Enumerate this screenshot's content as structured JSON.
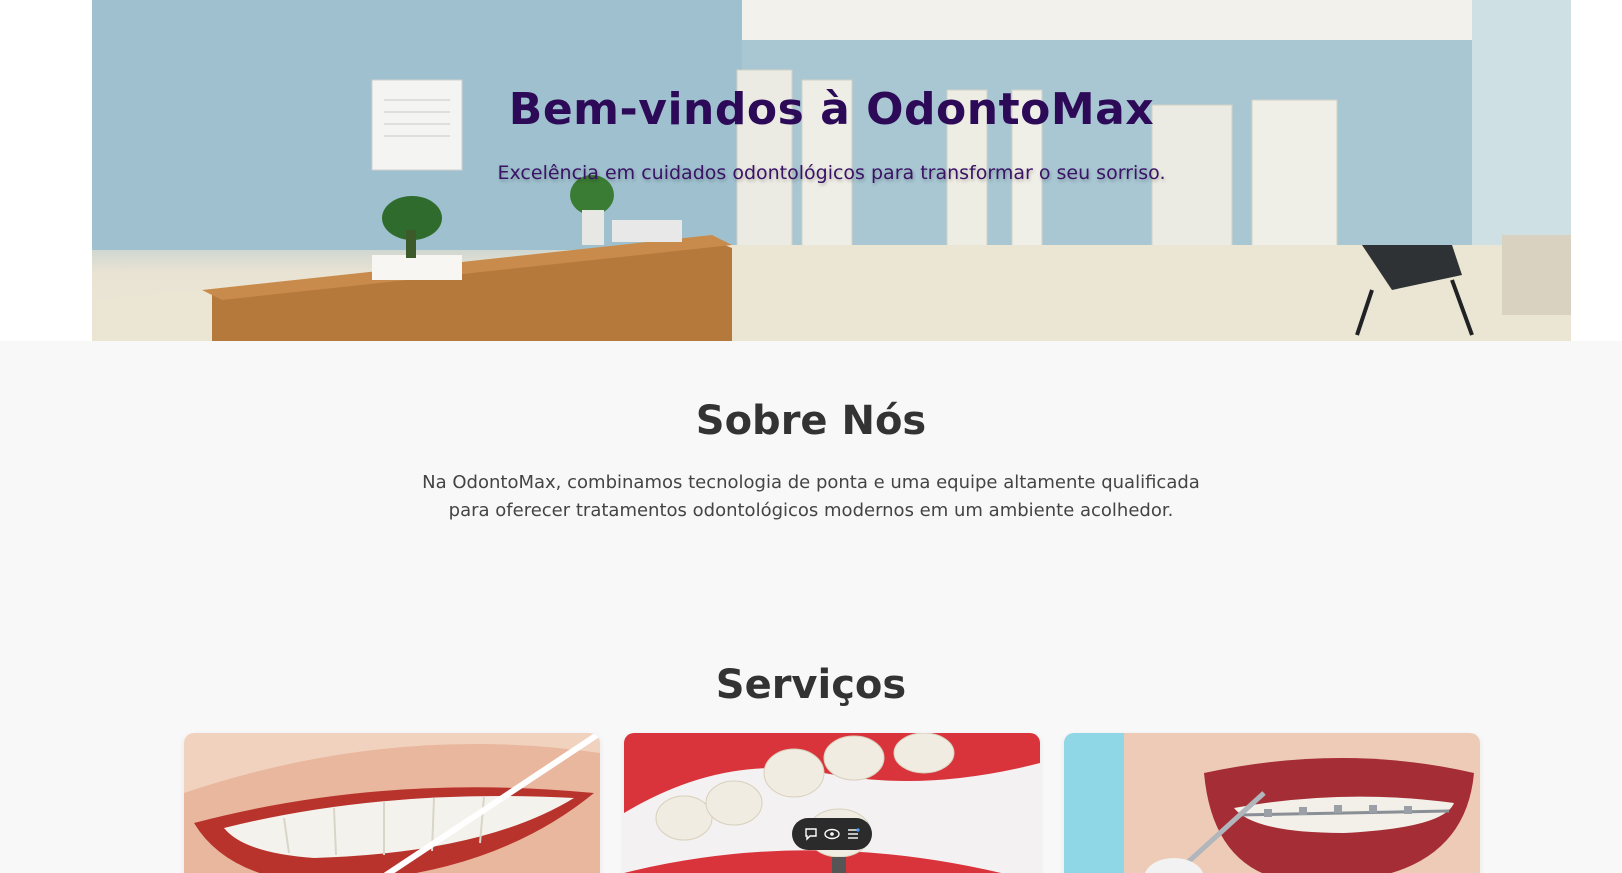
{
  "hero": {
    "title": "Bem-vindos à OdontoMax",
    "subtitle": "Excelência em cuidados odontológicos para transformar o seu sorriso."
  },
  "about": {
    "title": "Sobre Nós",
    "text": "Na OdontoMax, combinamos tecnologia de ponta e uma equipe altamente qualificada para oferecer tratamentos odontológicos modernos em um ambiente acolhedor."
  },
  "services": {
    "title": "Serviços",
    "cards": [
      {
        "image": "teeth-whitening-image"
      },
      {
        "image": "dental-implant-image"
      },
      {
        "image": "braces-image"
      }
    ]
  },
  "toolbar": {
    "icons": [
      "comment-icon",
      "eye-icon",
      "menu-icon"
    ]
  },
  "colors": {
    "hero_title": "#2d0a57",
    "background": "#f8f8f9",
    "heading": "#333333"
  }
}
